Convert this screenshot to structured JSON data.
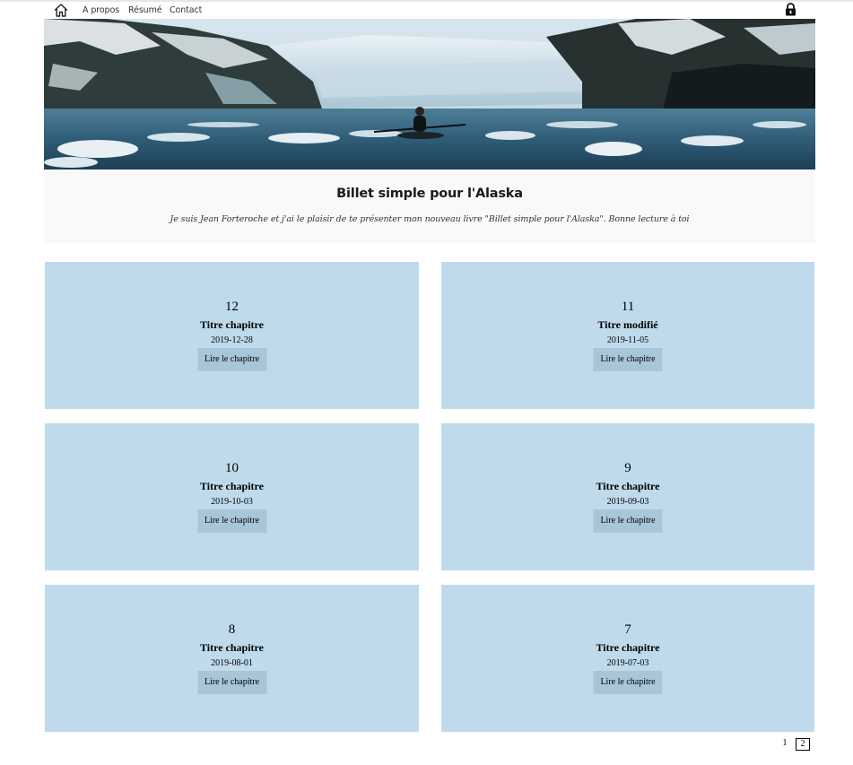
{
  "nav": {
    "home_icon": "home-icon",
    "links": [
      "A propos",
      "Résumé",
      "Contact"
    ],
    "lock_icon": "lock-icon"
  },
  "banner": {
    "description_icon": "alaska-glacier-kayak-banner"
  },
  "header": {
    "title": "Billet simple pour l'Alaska",
    "subtitle": "Je suis Jean Forteroche et j'ai le plaisir de te présenter mon nouveau livre \"Billet simple pour l'Alaska\". Bonne lecture à toi"
  },
  "chapters": [
    {
      "number": "12",
      "title": "Titre chapitre",
      "date": "2019-12-28",
      "button": "Lire le chapitre"
    },
    {
      "number": "11",
      "title": "Titre modifié",
      "date": "2019-11-05",
      "button": "Lire le chapitre"
    },
    {
      "number": "10",
      "title": "Titre chapitre",
      "date": "2019-10-03",
      "button": "Lire le chapitre"
    },
    {
      "number": "9",
      "title": "Titre chapitre",
      "date": "2019-09-03",
      "button": "Lire le chapitre"
    },
    {
      "number": "8",
      "title": "Titre chapitre",
      "date": "2019-08-01",
      "button": "Lire le chapitre"
    },
    {
      "number": "7",
      "title": "Titre chapitre",
      "date": "2019-07-03",
      "button": "Lire le chapitre"
    }
  ],
  "pagination": {
    "pages": [
      "1",
      "2"
    ],
    "current": "2"
  },
  "colors": {
    "card_bg": "#bfdaeb",
    "button_bg": "#a9c6d8",
    "header_bg": "#fbf8fa"
  }
}
